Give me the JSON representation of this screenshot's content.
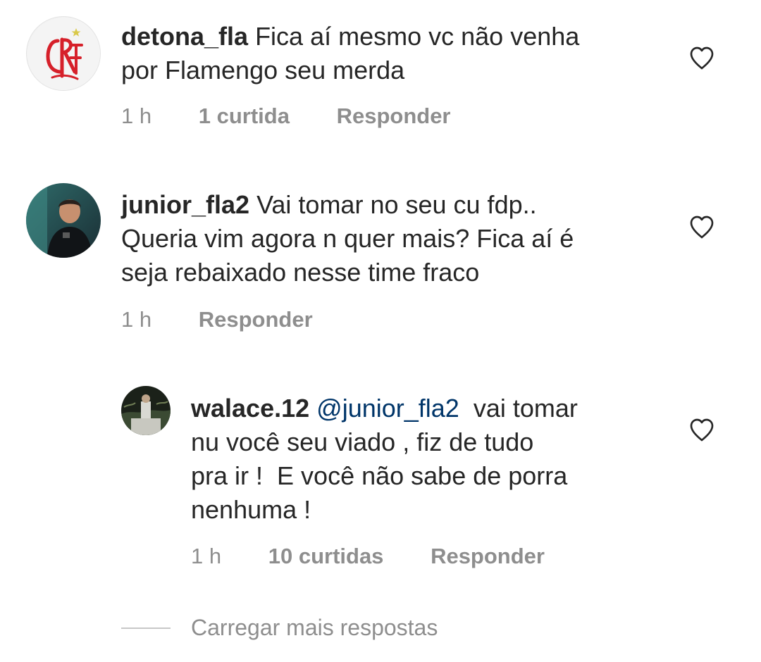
{
  "comments": [
    {
      "username": "detona_fla",
      "text_lines": [
        "Fica aí mesmo vc não venha",
        "por Flamengo seu merda"
      ],
      "time": "1 h",
      "likes": "1 curtida",
      "reply": "Responder",
      "avatar_icon": "flamengo-crest-icon"
    },
    {
      "username": "junior_fla2",
      "text_lines": [
        "Vai tomar no seu cu fdp..",
        "Queria vim agora n quer mais? Fica aí é",
        "seja rebaixado nesse time fraco"
      ],
      "time": "1 h",
      "reply": "Responder",
      "avatar_icon": "user-photo-avatar"
    },
    {
      "username": "walace.12",
      "mention": "@junior_fla2",
      "text_lines": [
        " vai tomar",
        "nu você seu viado , fiz de tudo",
        "pra ir !  E você não sabe de porra",
        "nenhuma !"
      ],
      "time": "1 h",
      "likes": "10 curtidas",
      "reply": "Responder",
      "avatar_icon": "user-photo-avatar"
    }
  ],
  "load_more": {
    "label": "Carregar mais respostas"
  },
  "colors": {
    "text": "#262626",
    "meta": "#8e8e8e",
    "mention": "#003569",
    "flamengo_red": "#d6202a"
  }
}
